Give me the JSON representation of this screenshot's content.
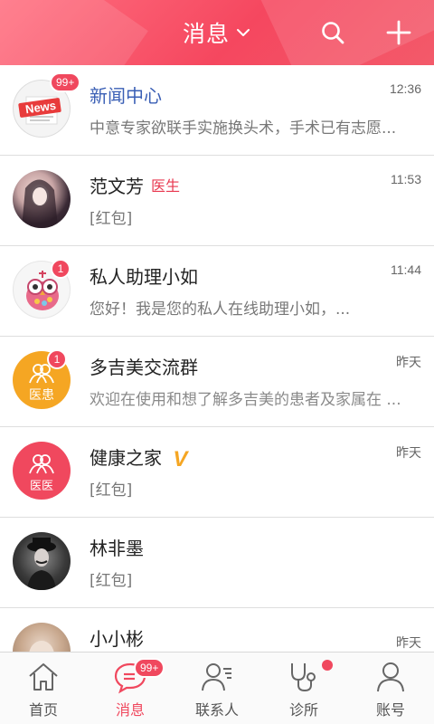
{
  "header": {
    "title": "消息",
    "search_icon": "search-icon",
    "add_icon": "plus-icon",
    "colors": {
      "accent": "#f24d62"
    }
  },
  "conversations": [
    {
      "name": "新闻中心",
      "time": "12:36",
      "preview": "中意专家欲联手实施换头术，手术已有志愿...",
      "badge": "99+",
      "avatar_text": "News"
    },
    {
      "name": "范文芳",
      "tag": "医生",
      "time": "11:53",
      "preview": "[红包]"
    },
    {
      "name": "私人助理小如",
      "time": "11:44",
      "preview": "您好！我是您的私人在线助理小如，...",
      "badge": "1"
    },
    {
      "name": "多吉美交流群",
      "time": "昨天",
      "preview": "欢迎在使用和想了解多吉美的患者及家属在 ...",
      "badge": "1",
      "avatar_text": "医患"
    },
    {
      "name": "健康之家",
      "verified": "V",
      "time": "昨天",
      "preview": "[红包]",
      "avatar_text": "医医"
    },
    {
      "name": "林非墨",
      "time": "",
      "preview": "[红包]"
    },
    {
      "name": "小小彬",
      "time": "昨天",
      "preview": ""
    }
  ],
  "tabbar": {
    "items": [
      {
        "label": "首页",
        "icon": "home-icon"
      },
      {
        "label": "消息",
        "icon": "message-icon",
        "badge": "99+"
      },
      {
        "label": "联系人",
        "icon": "contacts-icon"
      },
      {
        "label": "诊所",
        "icon": "stethoscope-icon"
      },
      {
        "label": "账号",
        "icon": "account-icon"
      }
    ]
  }
}
